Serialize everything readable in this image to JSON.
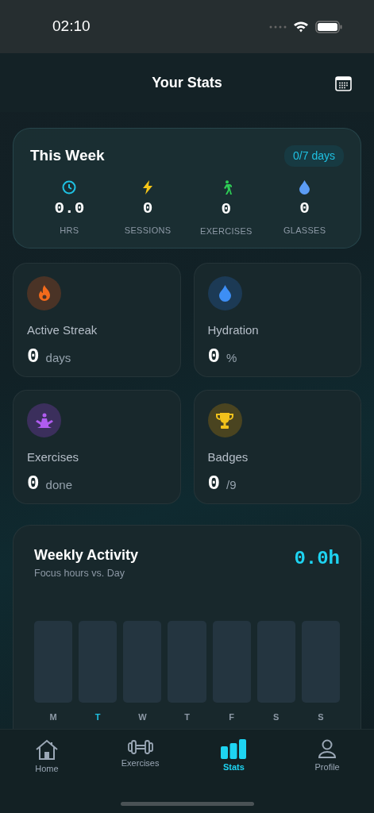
{
  "status_bar": {
    "time": "02:10"
  },
  "header": {
    "title": "Your Stats"
  },
  "this_week": {
    "title": "This Week",
    "badge": "0/7 days",
    "stats": [
      {
        "value": "0.0",
        "label": "HRS"
      },
      {
        "value": "0",
        "label": "SESSIONS"
      },
      {
        "value": "0",
        "label": "EXERCISES"
      },
      {
        "value": "0",
        "label": "GLASSES"
      }
    ]
  },
  "tiles": [
    {
      "title": "Active Streak",
      "value": "0",
      "unit": "days"
    },
    {
      "title": "Hydration",
      "value": "0",
      "unit": "%"
    },
    {
      "title": "Exercises",
      "value": "0",
      "unit": "done"
    },
    {
      "title": "Badges",
      "value": "0",
      "unit": "/9"
    }
  ],
  "weekly_activity": {
    "title": "Weekly Activity",
    "subtitle": "Focus hours vs. Day",
    "total": "0.0h",
    "days": [
      {
        "label": "M",
        "selected": false
      },
      {
        "label": "T",
        "selected": true
      },
      {
        "label": "W",
        "selected": false
      },
      {
        "label": "T",
        "selected": false
      },
      {
        "label": "F",
        "selected": false
      },
      {
        "label": "S",
        "selected": false
      },
      {
        "label": "S",
        "selected": false
      }
    ]
  },
  "tab_bar": [
    {
      "label": "Home",
      "selected": false
    },
    {
      "label": "Exercises",
      "selected": false
    },
    {
      "label": "Stats",
      "selected": true
    },
    {
      "label": "Profile",
      "selected": false
    }
  ]
}
